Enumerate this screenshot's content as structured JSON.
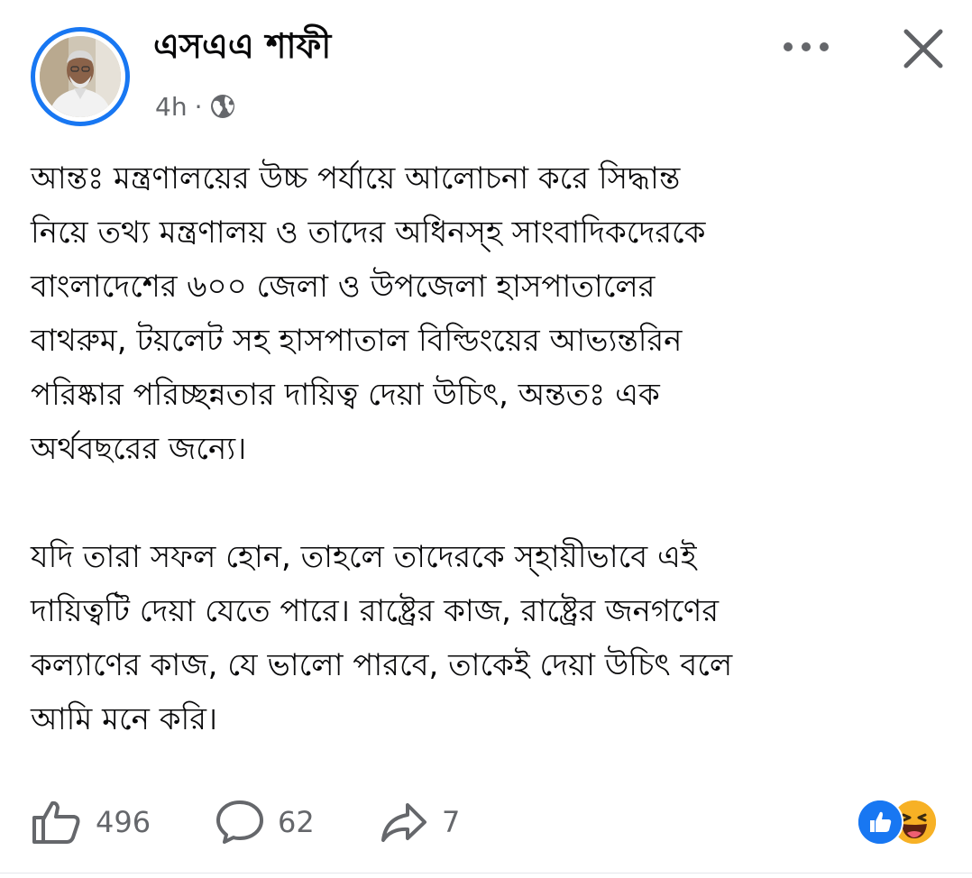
{
  "author": {
    "name": "এসএএ শাফী"
  },
  "meta": {
    "time": "4h",
    "separator": "·",
    "audience_icon": "globe-icon"
  },
  "header_actions": {
    "more_icon": "more-dots-icon",
    "close_icon": "close-icon"
  },
  "post": {
    "paragraph1_lines": [
      "আন্তঃ মন্ত্রণালয়ের উচ্চ পর্যায়ে আলোচনা করে সিদ্ধান্ত",
      "নিয়ে তথ্য মন্ত্রণালয় ও তাদের অধিনস্হ সাংবাদিকদেরকে",
      "বাংলাদেশের ৬০০ জেলা ও উপজেলা হাসপাতালের",
      "বাথরুম, টয়লেট সহ হাসপাতাল বিল্ডিংয়ের আভ্যন্তরিন",
      "পরিষ্কার পরিচ্ছন্নতার দায়িত্ব দেয়া উচিৎ, অন্ততঃ এক",
      "অর্থবছরের জন্যে।"
    ],
    "paragraph2_lines": [
      "যদি তারা সফল হোন, তাহলে তাদেরকে স্হায়ীভাবে এই",
      "দায়িত্বটি দেয়া যেতে পারে। রাষ্ট্রের কাজ, রাষ্ট্রের জনগণের",
      "কল্যাণের কাজ, যে ভালো পারবে, তাকেই দেয়া উচিৎ বলে",
      "আমি মনে করি।"
    ]
  },
  "stats": {
    "likes": "496",
    "comments": "62",
    "shares": "7"
  },
  "reactions": [
    "like-icon",
    "haha-icon"
  ],
  "colors": {
    "accent": "#1877f2",
    "secondary_text": "#65676b",
    "primary_text": "#080809",
    "haha_yellow": "#f7b125"
  }
}
